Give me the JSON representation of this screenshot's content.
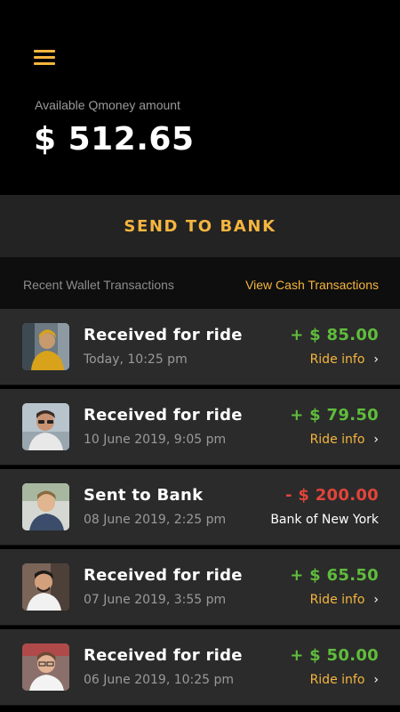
{
  "header": {
    "menu_icon": "hamburger-menu-icon",
    "balance_label": "Available Qmoney amount",
    "balance_amount": "$ 512.65"
  },
  "actions": {
    "send_to_bank_label": "SEND TO BANK"
  },
  "section": {
    "title": "Recent Wallet Transactions",
    "link_label": "View Cash Transactions"
  },
  "colors": {
    "accent": "#f5b53f",
    "positive": "#5fbd3c",
    "negative": "#e2443a",
    "row_bg": "#2b2b2b"
  },
  "transactions": [
    {
      "title": "Received for ride",
      "date": "Today, 10:25 pm",
      "amount": "+ $ 85.00",
      "direction": "plus",
      "sub_label": "Ride info",
      "sub_icon": "chevron-right-icon"
    },
    {
      "title": "Received for ride",
      "date": "10 June 2019, 9:05 pm",
      "amount": "+ $ 79.50",
      "direction": "plus",
      "sub_label": "Ride info",
      "sub_icon": "chevron-right-icon"
    },
    {
      "title": "Sent to Bank",
      "date": "08 June 2019, 2:25 pm",
      "amount": "- $ 200.00",
      "direction": "minus",
      "sub_label": "Bank of New York"
    },
    {
      "title": "Received for ride",
      "date": "07 June 2019, 3:55 pm",
      "amount": "+ $ 65.50",
      "direction": "plus",
      "sub_label": "Ride info",
      "sub_icon": "chevron-right-icon"
    },
    {
      "title": "Received for ride",
      "date": "06 June 2019, 10:25 pm",
      "amount": "+ $ 50.00",
      "direction": "plus",
      "sub_label": "Ride info",
      "sub_icon": "chevron-right-icon"
    }
  ]
}
